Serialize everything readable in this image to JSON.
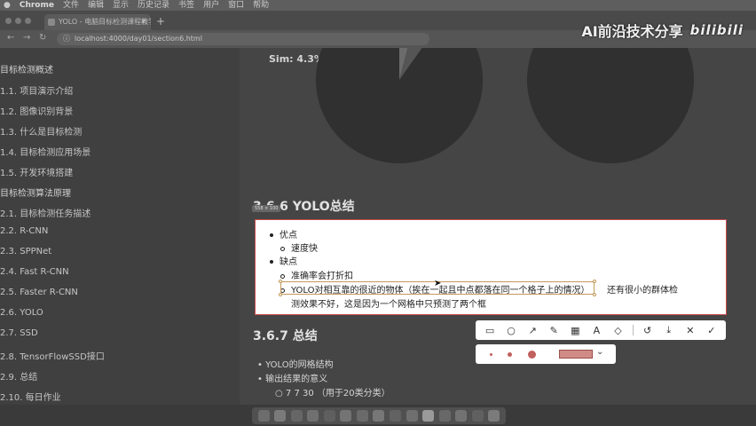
{
  "menubar": {
    "app": "Chrome",
    "items": [
      "文件",
      "编辑",
      "显示",
      "历史记录",
      "书签",
      "用户",
      "窗口",
      "帮助"
    ]
  },
  "browser": {
    "tab_title": "YOLO - 电脑目标检测课程教学",
    "url": "localhost:4000/day01/section6.html"
  },
  "watermark": {
    "text": "AI前沿技术分享",
    "logo": "bilibili"
  },
  "sidebar": {
    "items": [
      {
        "label": "目标检测概述",
        "kind": "section"
      },
      {
        "label": "1.1. 项目演示介绍",
        "kind": "item"
      },
      {
        "label": "1.2. 图像识别背景",
        "kind": "item"
      },
      {
        "label": "1.3. 什么是目标检测",
        "kind": "item"
      },
      {
        "label": "1.4. 目标检测应用场景",
        "kind": "item"
      },
      {
        "label": "1.5. 开发环境搭建",
        "kind": "item"
      },
      {
        "label": "目标检测算法原理",
        "kind": "section"
      },
      {
        "label": "2.1. 目标检测任务描述",
        "kind": "item"
      },
      {
        "label": "2.2. R-CNN",
        "kind": "item"
      },
      {
        "label": "2.3. SPPNet",
        "kind": "item"
      },
      {
        "label": "2.4. Fast R-CNN",
        "kind": "item"
      },
      {
        "label": "2.5. Faster R-CNN",
        "kind": "item"
      },
      {
        "label": "2.6. YOLO",
        "kind": "item"
      },
      {
        "label": "2.7. SSD",
        "kind": "item"
      },
      {
        "label": "2.8. TensorFlowSSD接口",
        "kind": "item"
      },
      {
        "label": "2.9. 总结",
        "kind": "item"
      },
      {
        "label": "2.10. 每日作业",
        "kind": "item"
      }
    ]
  },
  "main": {
    "sim_label": "Sim: 4.3%",
    "section_666": "3.6.6 YOLO总结",
    "tooltip": "558 × 100",
    "highlight": {
      "advantages": "优点",
      "adv_items": [
        "速度快"
      ],
      "disadvantages": "缺点",
      "dis_items": [
        "准确率会打折扣",
        "YOLO对相互靠的很近的物体（挨在一起且中点都落在同一个格子上的情况）",
        "还有很小的群体检",
        "测效果不好，这是因为一个网格中只预测了两个框"
      ]
    },
    "section_667": "3.6.7 总结",
    "summary_items": [
      "YOLO的网格结构",
      "输出结果的意义"
    ],
    "summary_sub": [
      "7 7 30 （用于20类分类）"
    ]
  },
  "toolbar": {
    "tools": [
      "rectangle-icon",
      "ellipse-icon",
      "arrow-icon",
      "pen-icon",
      "mosaic-icon",
      "text-icon",
      "eraser-icon",
      "undo-icon",
      "save-icon",
      "close-icon",
      "confirm-icon"
    ]
  },
  "colors": {
    "annotation": "#c0605c",
    "highlight_border": "#c84b4b",
    "dim_background": "#454545"
  }
}
